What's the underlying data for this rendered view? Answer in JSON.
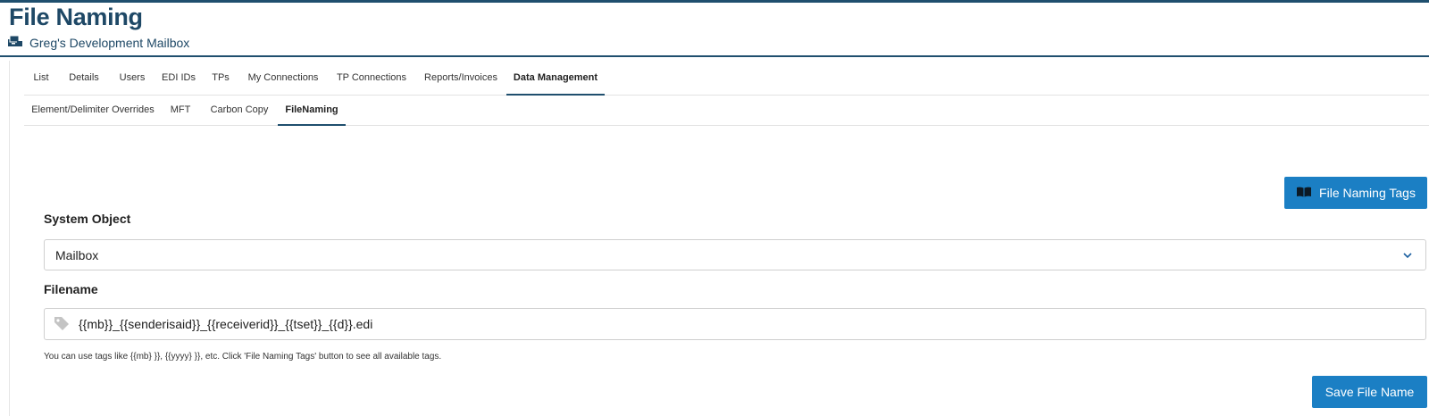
{
  "header": {
    "title": "File Naming",
    "mailbox": "Greg's Development Mailbox",
    "mailbox_icon": "mailbox-icon"
  },
  "tabs_primary": [
    {
      "label": "List",
      "active": false
    },
    {
      "label": "Details",
      "active": false
    },
    {
      "label": "Users",
      "active": false
    },
    {
      "label": "EDI IDs",
      "active": false
    },
    {
      "label": "TPs",
      "active": false
    },
    {
      "label": "My Connections",
      "active": false
    },
    {
      "label": "TP Connections",
      "active": false
    },
    {
      "label": "Reports/Invoices",
      "active": false
    },
    {
      "label": "Data Management",
      "active": true
    }
  ],
  "tabs_secondary": [
    {
      "label": "Element/Delimiter Overrides",
      "active": false
    },
    {
      "label": "MFT",
      "active": false
    },
    {
      "label": "Carbon Copy",
      "active": false
    },
    {
      "label": "FileNaming",
      "active": true
    }
  ],
  "tags_button": {
    "label": "File Naming Tags",
    "icon": "book-icon"
  },
  "form": {
    "system_object_label": "System Object",
    "system_object_value": "Mailbox",
    "filename_label": "Filename",
    "filename_value": "{{mb}}_{{senderisaid}}_{{receiverid}}_{{tset}}_{{d}}.edi",
    "filename_icon": "tag-icon",
    "help_text": "You can use tags like {{mb} }}, {{yyyy} }}, etc. Click 'File Naming Tags' button to see all available tags."
  },
  "save_button": {
    "label": "Save File Name"
  },
  "colors": {
    "primary": "#1b7fc4",
    "header": "#1e4866"
  }
}
